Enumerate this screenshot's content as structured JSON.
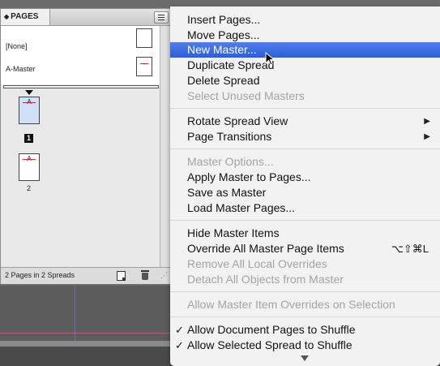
{
  "panel": {
    "tab_label": "PAGES",
    "masters": [
      {
        "label": "[None]"
      },
      {
        "label": "A-Master"
      }
    ],
    "pages": [
      {
        "master_prefix": "A",
        "number": "1"
      },
      {
        "master_prefix": "A",
        "number": "2"
      }
    ],
    "footer_status": "2 Pages in 2 Spreads"
  },
  "menu": {
    "items": [
      {
        "label": "Insert Pages..."
      },
      {
        "label": "Move Pages..."
      },
      {
        "label": "New Master..."
      },
      {
        "label": "Duplicate Spread"
      },
      {
        "label": "Delete Spread"
      },
      {
        "label": "Select Unused Masters"
      },
      {
        "label": "Rotate Spread View"
      },
      {
        "label": "Page Transitions"
      },
      {
        "label": "Master Options..."
      },
      {
        "label": "Apply Master to Pages..."
      },
      {
        "label": "Save as Master"
      },
      {
        "label": "Load Master Pages..."
      },
      {
        "label": "Hide Master Items"
      },
      {
        "label": "Override All Master Page Items",
        "shortcut": "⌥⇧⌘L"
      },
      {
        "label": "Remove All Local Overrides"
      },
      {
        "label": "Detach All Objects from Master"
      },
      {
        "label": "Allow Master Item Overrides on Selection"
      },
      {
        "label": "Allow Document Pages to Shuffle",
        "check": "✓"
      },
      {
        "label": "Allow Selected Spread to Shuffle",
        "check": "✓"
      }
    ],
    "submenu_glyph": "▶",
    "highlight_color": "#2d5ddb"
  }
}
